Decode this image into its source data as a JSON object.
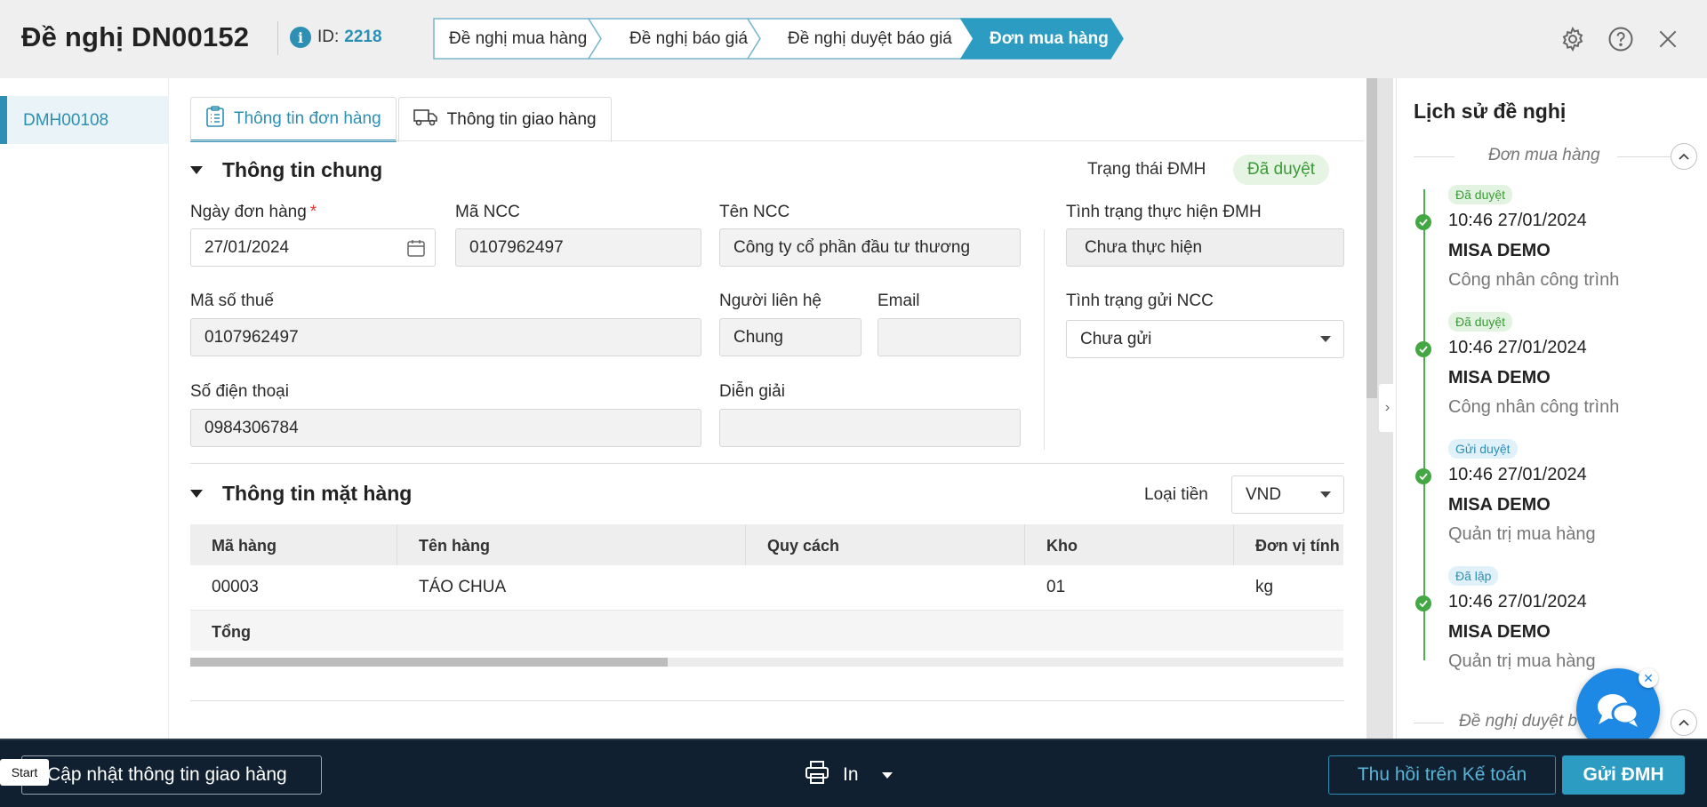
{
  "header": {
    "title": "Đề nghị DN00152",
    "id_label": "ID:",
    "id_value": "2218",
    "steps": [
      "Đề nghị mua hàng",
      "Đề nghị báo giá",
      "Đề nghị duyệt báo giá",
      "Đơn mua hàng"
    ],
    "active_step": 3,
    "icons": [
      "gear-icon",
      "help-icon",
      "close-icon"
    ]
  },
  "left_list": {
    "items": [
      "DMH00108"
    ]
  },
  "tabs": [
    {
      "label": "Thông tin đơn hàng",
      "icon": "clipboard-icon"
    },
    {
      "label": "Thông tin giao hàng",
      "icon": "truck-icon"
    }
  ],
  "general": {
    "heading": "Thông tin chung",
    "status_label": "Trạng thái ĐMH",
    "status_value": "Đã duyệt",
    "order_date_label": "Ngày đơn hàng",
    "required_mark": "*",
    "order_date_value": "27/01/2024",
    "supplier_code_label": "Mã NCC",
    "supplier_code_value": "0107962497",
    "supplier_name_label": "Tên NCC",
    "supplier_name_value": "Công ty cổ phần đầu tư thương",
    "exec_status_label": "Tình trạng thực hiện ĐMH",
    "exec_status_value": "Chưa thực hiện",
    "tax_code_label": "Mã số thuế",
    "tax_code_value": "0107962497",
    "contact_label": "Người liên hệ",
    "contact_value": "Chung",
    "email_label": "Email",
    "email_value": "",
    "send_status_label": "Tình trạng gửi NCC",
    "send_status_value": "Chưa gửi",
    "phone_label": "Số điện thoại",
    "phone_value": "0984306784",
    "note_label": "Diễn giải",
    "note_value": ""
  },
  "items": {
    "heading": "Thông tin mặt hàng",
    "currency_label": "Loại tiền",
    "currency_value": "VND",
    "columns": [
      "Mã hàng",
      "Tên hàng",
      "Quy cách",
      "Kho",
      "Đơn vị tính"
    ],
    "rows": [
      [
        "00003",
        "TÁO CHUA",
        "",
        "01",
        "kg"
      ]
    ],
    "total_label": "Tổng"
  },
  "history": {
    "title": "Lịch sử đề nghị",
    "group1": "Đơn mua hàng",
    "group2": "Đề nghị duyệt b",
    "events": [
      {
        "badge": "Đã duyệt",
        "time": "10:46 27/01/2024",
        "user": "MISA DEMO",
        "role": "Công nhân công trình"
      },
      {
        "badge": "Đã duyệt",
        "time": "10:46 27/01/2024",
        "user": "MISA DEMO",
        "role": "Công nhân công trình"
      },
      {
        "badge": "Gửi duyệt",
        "time": "10:46 27/01/2024",
        "user": "MISA DEMO",
        "role": "Quản trị mua hàng"
      },
      {
        "badge": "Đã lập",
        "time": "10:46 27/01/2024",
        "user": "MISA DEMO",
        "role": "Quản trị mua hàng"
      }
    ]
  },
  "footer": {
    "update_button": "Cập nhật thông tin giao hàng",
    "start_label": "Start",
    "print_label": "In",
    "recall_button": "Thu hồi trên Kế toán",
    "send_button": "Gửi ĐMH"
  },
  "colors": {
    "accent": "#2d8fb3",
    "approved": "#3b9b36",
    "footer": "#102030"
  }
}
